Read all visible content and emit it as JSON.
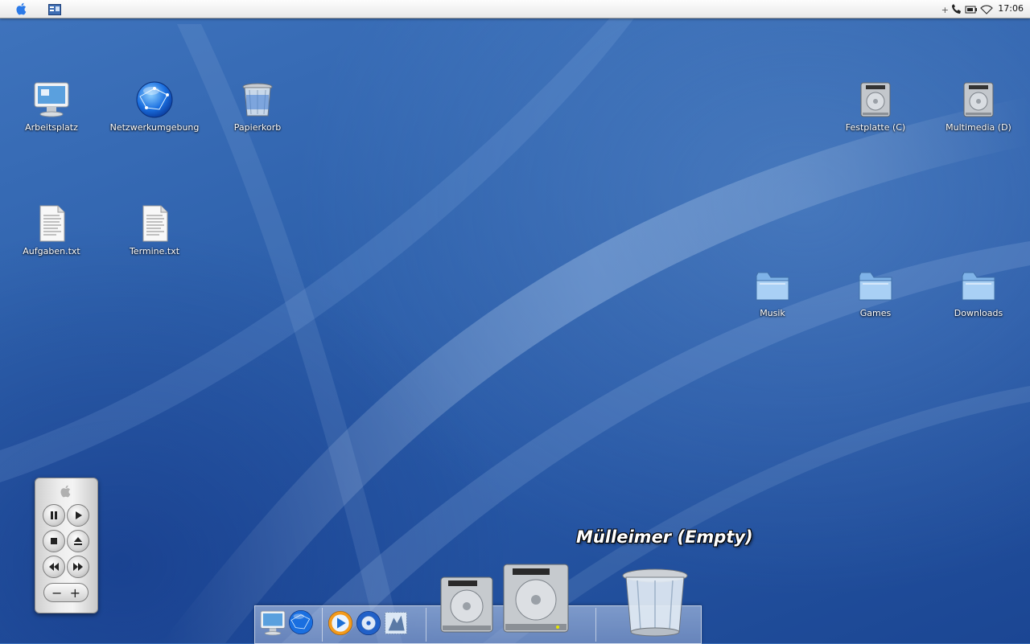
{
  "menubar": {
    "apple_menu_icon": "apple-icon",
    "app_icon": "window-list-icon",
    "tray_icons": [
      "plus-icon",
      "phone-icon",
      "battery-icon",
      "wifi-icon"
    ],
    "clock": "17:06"
  },
  "desktop": {
    "icons": [
      {
        "label": "Arbeitsplatz",
        "icon": "computer-icon"
      },
      {
        "label": "Netzwerkumgebung",
        "icon": "network-globe-icon"
      },
      {
        "label": "Papierkorb",
        "icon": "trash-icon"
      },
      {
        "label": "Festplatte (C)",
        "icon": "hard-drive-icon"
      },
      {
        "label": "Multimedia (D)",
        "icon": "hard-drive-icon"
      },
      {
        "label": "Aufgaben.txt",
        "icon": "text-file-icon"
      },
      {
        "label": "Termine.txt",
        "icon": "text-file-icon"
      },
      {
        "label": "Musik",
        "icon": "folder-icon"
      },
      {
        "label": "Games",
        "icon": "folder-icon"
      },
      {
        "label": "Downloads",
        "icon": "folder-icon"
      }
    ]
  },
  "remote": {
    "buttons": [
      "pause",
      "play",
      "stop",
      "eject",
      "rewind",
      "fast-forward"
    ],
    "volume_minus": "−",
    "volume_plus": "+"
  },
  "dock": {
    "hover_label": "Mülleimer (Empty)",
    "items": [
      "computer-icon",
      "network-globe-icon",
      "media-player-icon",
      "dvd-player-icon",
      "mail-stamp-icon",
      "hard-drive-icon",
      "hard-drive-icon",
      "trash-icon"
    ]
  },
  "colors": {
    "desktop_blue": "#2f62ad",
    "label_text": "#ffffff"
  }
}
